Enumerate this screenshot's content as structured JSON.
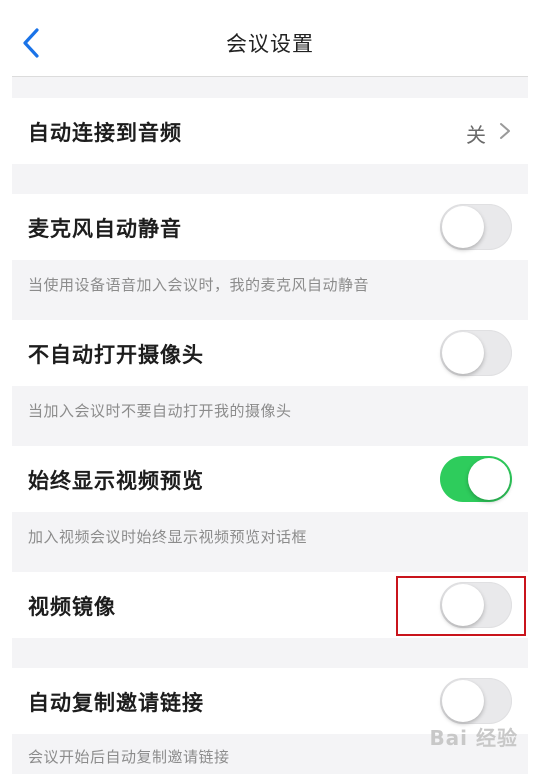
{
  "header": {
    "title": "会议设置",
    "back_icon": "chevron-left-icon"
  },
  "colors": {
    "accent": "#1a73e8",
    "toggle_on": "#2ecc5c",
    "highlight": "#c9141c"
  },
  "settings": {
    "auto_audio": {
      "label": "自动连接到音频",
      "value": "关"
    },
    "mic_mute": {
      "label": "麦克风自动静音",
      "enabled": false,
      "description": "当使用设备语音加入会议时，我的麦克风自动静音"
    },
    "no_camera": {
      "label": "不自动打开摄像头",
      "enabled": false,
      "description": "当加入会议时不要自动打开我的摄像头"
    },
    "video_preview": {
      "label": "始终显示视频预览",
      "enabled": true,
      "description": "加入视频会议时始终显示视频预览对话框"
    },
    "video_mirror": {
      "label": "视频镜像",
      "enabled": false
    },
    "copy_invite": {
      "label": "自动复制邀请链接",
      "enabled": false,
      "description": "会议开始后自动复制邀请链接"
    }
  },
  "watermark": "Bai 经验"
}
